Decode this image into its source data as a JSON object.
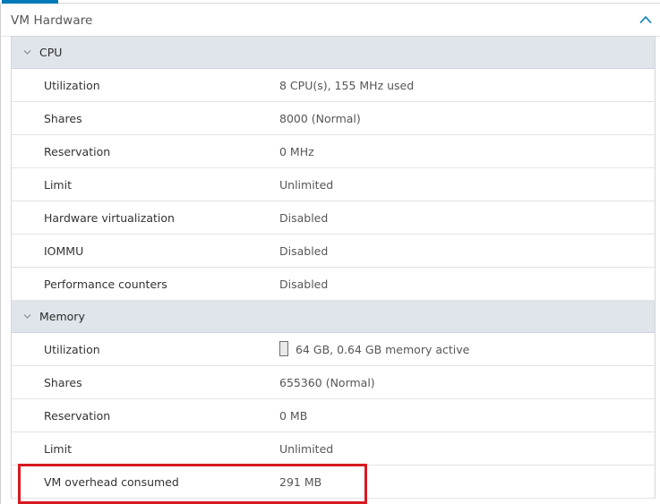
{
  "card": {
    "title": "VM Hardware",
    "collapse_icon": "chevron-up-icon"
  },
  "cpu": {
    "label": "CPU",
    "rows": [
      {
        "label": "Utilization",
        "value": "8 CPU(s), 155 MHz used"
      },
      {
        "label": "Shares",
        "value": "8000 (Normal)"
      },
      {
        "label": "Reservation",
        "value": "0 MHz"
      },
      {
        "label": "Limit",
        "value": "Unlimited"
      },
      {
        "label": "Hardware virtualization",
        "value": "Disabled"
      },
      {
        "label": "IOMMU",
        "value": "Disabled"
      },
      {
        "label": "Performance counters",
        "value": "Disabled"
      }
    ]
  },
  "memory": {
    "label": "Memory",
    "rows": [
      {
        "label": "Utilization",
        "value": "64 GB, 0.64 GB memory active",
        "usage_fraction": 0.01
      },
      {
        "label": "Shares",
        "value": "655360 (Normal)"
      },
      {
        "label": "Reservation",
        "value": "0 MB"
      },
      {
        "label": "Limit",
        "value": "Unlimited"
      },
      {
        "label": "VM overhead consumed",
        "value": "291 MB"
      }
    ]
  },
  "colors": {
    "group_header_bg": "#dfe5eb",
    "highlight": "#d71920",
    "accent": "#0079b8"
  }
}
